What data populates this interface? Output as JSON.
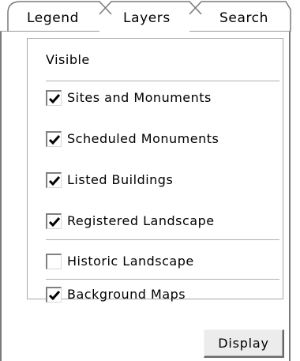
{
  "tabs": [
    {
      "label": "Legend",
      "active": false
    },
    {
      "label": "Layers",
      "active": true
    },
    {
      "label": "Search",
      "active": false
    }
  ],
  "layers_panel": {
    "group_title": "Visible",
    "items": [
      {
        "label": "Sites and Monuments",
        "checked": true
      },
      {
        "label": "Scheduled Monuments",
        "checked": true
      },
      {
        "label": "Listed Buildings",
        "checked": true
      },
      {
        "label": "Registered Landscape",
        "checked": true
      },
      {
        "label": "Historic Landscape",
        "checked": false
      },
      {
        "label": "Background Maps",
        "checked": true
      }
    ]
  },
  "display_button_label": "Display",
  "icons": {
    "checkbox_checked": "checkmark-icon"
  }
}
